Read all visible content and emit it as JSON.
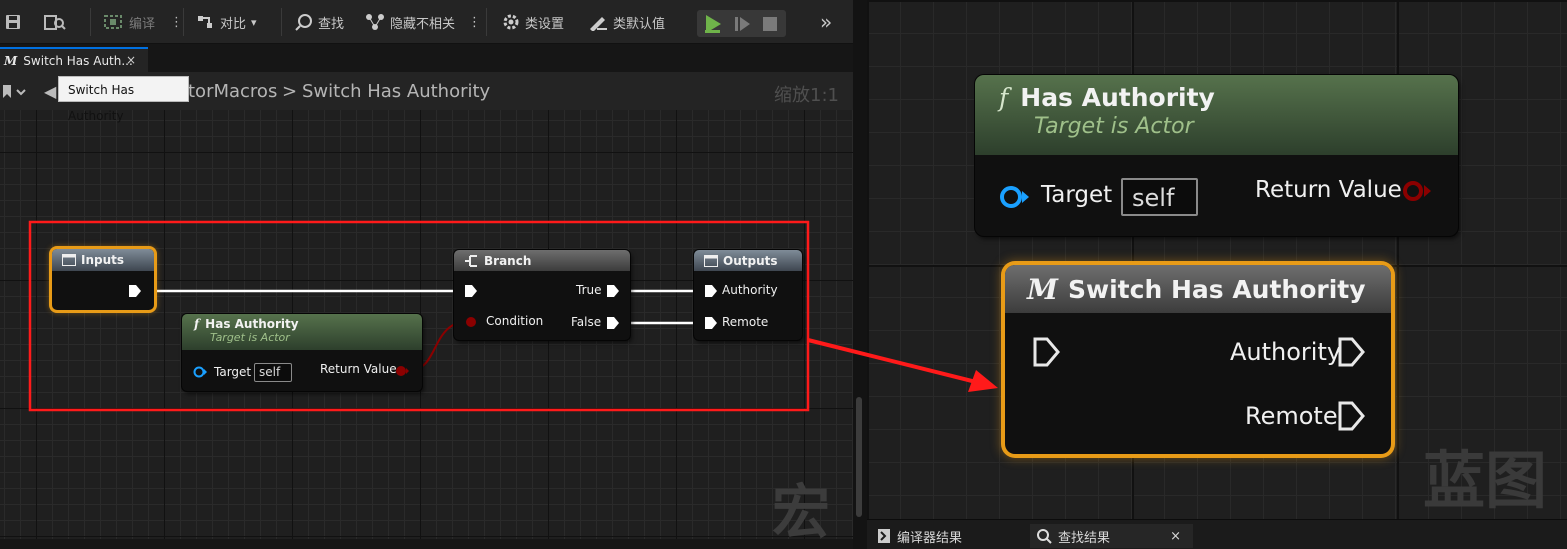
{
  "toolbar": {
    "compile_label": "编译",
    "diff_label": "对比",
    "find_label": "查找",
    "hide_unrelated_label": "隐藏不相关",
    "class_settings_label": "类设置",
    "class_defaults_label": "类默认值"
  },
  "tab": {
    "label": "Switch Has Auth...",
    "close": "×"
  },
  "tooltip": "Switch Has Authority",
  "breadcrumb": {
    "parent": "torMacros",
    "separator": ">",
    "current": "Switch Has Authority"
  },
  "zoom": "缩放1:1",
  "left_graph": {
    "watermark": "宏",
    "inputs_node": {
      "title": "Inputs"
    },
    "has_authority_node": {
      "title": "Has Authority",
      "subtitle": "Target is Actor",
      "target_label": "Target",
      "target_value": "self",
      "return_label": "Return Value"
    },
    "branch_node": {
      "title": "Branch",
      "condition_label": "Condition",
      "true_label": "True",
      "false_label": "False"
    },
    "outputs_node": {
      "title": "Outputs",
      "authority_label": "Authority",
      "remote_label": "Remote"
    }
  },
  "right_graph": {
    "watermark": "蓝图",
    "has_authority_node": {
      "icon": "f",
      "title": "Has Authority",
      "subtitle": "Target is Actor",
      "target_label": "Target",
      "target_value": "self",
      "return_label": "Return Value"
    },
    "switch_node": {
      "icon": "M",
      "title": "Switch Has Authority",
      "authority_label": "Authority",
      "remote_label": "Remote"
    }
  },
  "bottom_tabs": {
    "compiler_results": "编译器结果",
    "find_results": "查找结果",
    "close": "×"
  },
  "colors": {
    "selection": "#e89b17",
    "annotation_red": "#ff1a1a",
    "exec_pin": "#ffffff",
    "bool_pin": "#8b0000",
    "object_pin": "#1aa0ff"
  }
}
